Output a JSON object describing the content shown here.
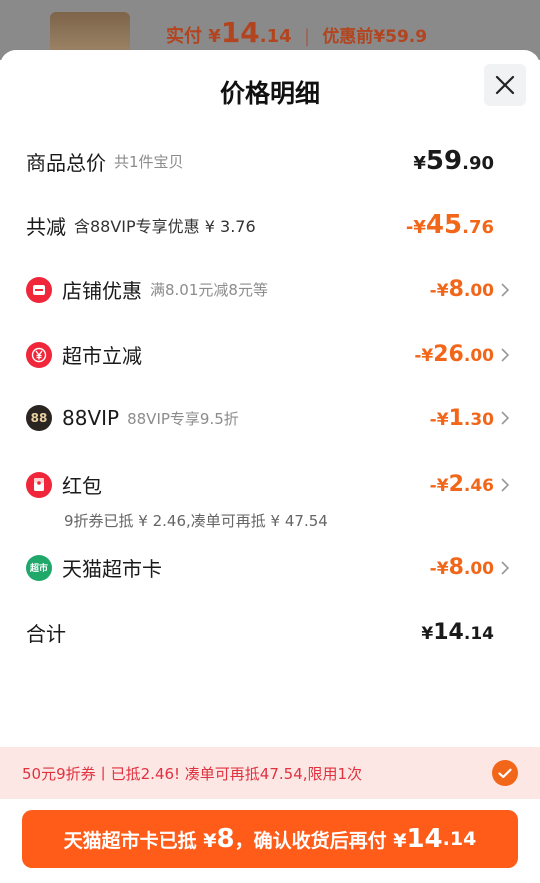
{
  "backdrop": {
    "paid_label": "实付",
    "paid_currency": "¥",
    "paid_int": "14",
    "paid_dec": ".14",
    "divider": "|",
    "before_label": "优惠前",
    "before_price": "¥59.9"
  },
  "sheet": {
    "title": "价格明细",
    "close_icon": "close-icon"
  },
  "rows": {
    "total_goods": {
      "label": "商品总价",
      "sub": "共1件宝贝",
      "currency": "¥",
      "int": "59",
      "dec": ".90"
    },
    "total_reduce": {
      "label": "共减",
      "sub": "含88VIP专享优惠 ¥ 3.76",
      "currency": "-¥",
      "int": "45",
      "dec": ".76"
    },
    "shop_discount": {
      "label": "店铺优惠",
      "sub": "满8.01元减8元等",
      "currency": "-¥",
      "int": "8",
      "dec": ".00",
      "icon": "shop-coupon-icon"
    },
    "market_reduce": {
      "label": "超市立减",
      "currency": "-¥",
      "int": "26",
      "dec": ".00",
      "icon": "yen-coin-icon"
    },
    "vip88": {
      "label": "88VIP",
      "sub": "88VIP专享9.5折",
      "currency": "-¥",
      "int": "1",
      "dec": ".30",
      "icon": "88vip-badge-icon",
      "badge": "88"
    },
    "red_packet": {
      "label": "红包",
      "note": "9折券已抵 ¥ 2.46,凑单可再抵 ¥ 47.54",
      "currency": "-¥",
      "int": "2",
      "dec": ".46",
      "icon": "red-packet-icon"
    },
    "tmall_card": {
      "label": "天猫超市卡",
      "currency": "-¥",
      "int": "8",
      "dec": ".00",
      "icon": "tmall-market-card-icon",
      "badge": "超市"
    },
    "sum": {
      "label": "合计",
      "currency": "¥",
      "int": "14",
      "dec": ".14"
    }
  },
  "coupon_bar": {
    "text": "50元9折券丨已抵2.46! 凑单可再抵47.54,限用1次",
    "checked": true
  },
  "confirm": {
    "text_a": "天猫超市卡已抵 ¥",
    "num_a": "8",
    "text_b": "，确认收货后再付 ¥",
    "num_b": "14",
    "dec_b": ".14"
  },
  "colors": {
    "accent_orange": "#f2661a",
    "button_orange": "#ff5c1a",
    "coupon_bg": "#fde7e4",
    "coupon_text": "#e0313f"
  }
}
